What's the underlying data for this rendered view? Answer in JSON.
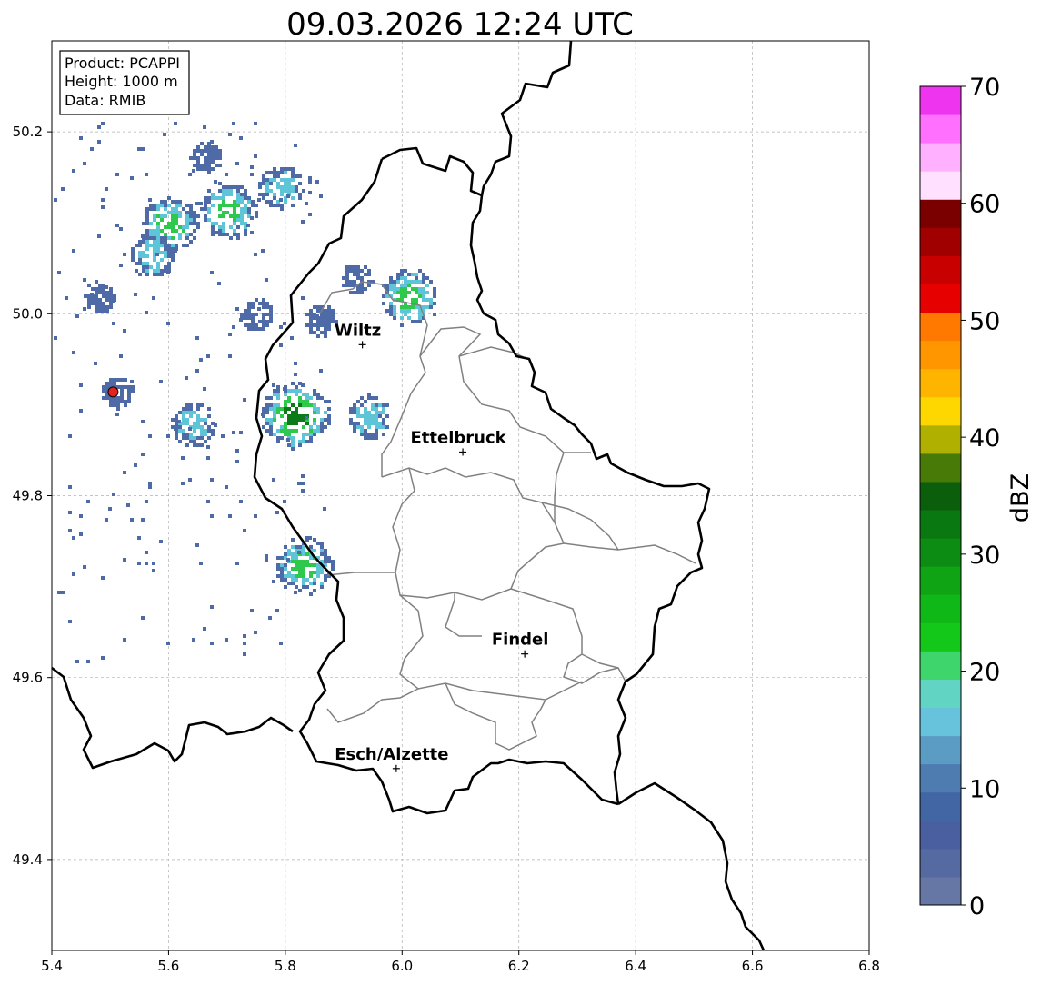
{
  "title": "09.03.2026 12:24 UTC",
  "info_box": {
    "lines": [
      "Product: PCAPPI",
      "Height: 1000 m",
      "Data: RMIB"
    ]
  },
  "axes": {
    "x_ticks": [
      "5.4",
      "5.6",
      "5.8",
      "6.0",
      "6.2",
      "6.4",
      "6.6",
      "6.8"
    ],
    "x_values": [
      5.4,
      5.6,
      5.8,
      6.0,
      6.2,
      6.4,
      6.6,
      6.8
    ],
    "y_ticks": [
      "49.4",
      "49.6",
      "49.8",
      "50.0",
      "50.2"
    ],
    "y_values": [
      49.4,
      49.6,
      49.8,
      50.0,
      50.2
    ],
    "xlim": [
      5.4,
      6.8
    ],
    "ylim": [
      49.3,
      50.3
    ],
    "grid": true
  },
  "cities": [
    {
      "name": "Wiltz",
      "lon": 5.932,
      "lat": 49.966
    },
    {
      "name": "Ettelbruck",
      "lon": 6.104,
      "lat": 49.848
    },
    {
      "name": "Findel",
      "lon": 6.21,
      "lat": 49.626
    },
    {
      "name": "Esch/Alzette",
      "lon": 5.99,
      "lat": 49.5
    }
  ],
  "radar_site": {
    "lon": 5.505,
    "lat": 49.914,
    "color": "#e0241c"
  },
  "colorbar": {
    "label": "dBZ",
    "ticks": [
      "0",
      "10",
      "20",
      "30",
      "40",
      "50",
      "60",
      "70"
    ],
    "tick_values": [
      0,
      10,
      20,
      30,
      40,
      50,
      60,
      70
    ],
    "range": [
      0,
      70
    ],
    "colors": [
      "#6677a6",
      "#566aa2",
      "#4a5fa0",
      "#4266a4",
      "#4e7cb0",
      "#5b9cc5",
      "#67c2dc",
      "#62d4c3",
      "#3ed66c",
      "#14c81a",
      "#0fb816",
      "#0ea414",
      "#0c8c12",
      "#0a7810",
      "#0a5e0c",
      "#487a08",
      "#b0b000",
      "#ffd700",
      "#ffb400",
      "#ff9600",
      "#ff7800",
      "#e60000",
      "#c80000",
      "#a00000",
      "#7a0000",
      "#ffe0ff",
      "#ffb0ff",
      "#ff70ff",
      "#ee34ee"
    ]
  },
  "colors": {
    "border": "#000000",
    "canton_border": "#808080",
    "echo_weak": "#4e6ba8",
    "echo_light": "#5ec5d9",
    "echo_moderate": "#2ec84c",
    "echo_strong": "#0c7a18"
  },
  "echo_cells": [
    {
      "lon": 5.6,
      "lat": 50.1,
      "intensity": 3
    },
    {
      "lon": 5.7,
      "lat": 50.115,
      "intensity": 3
    },
    {
      "lon": 5.79,
      "lat": 50.14,
      "intensity": 2
    },
    {
      "lon": 5.66,
      "lat": 50.175,
      "intensity": 1
    },
    {
      "lon": 5.57,
      "lat": 50.065,
      "intensity": 2
    },
    {
      "lon": 6.01,
      "lat": 50.02,
      "intensity": 3
    },
    {
      "lon": 5.815,
      "lat": 49.89,
      "intensity": 4
    },
    {
      "lon": 5.94,
      "lat": 49.888,
      "intensity": 2
    },
    {
      "lon": 5.86,
      "lat": 49.995,
      "intensity": 1
    },
    {
      "lon": 5.92,
      "lat": 50.04,
      "intensity": 1
    },
    {
      "lon": 5.64,
      "lat": 49.88,
      "intensity": 2
    },
    {
      "lon": 5.83,
      "lat": 49.725,
      "intensity": 3
    },
    {
      "lon": 5.51,
      "lat": 49.916,
      "intensity": 1
    },
    {
      "lon": 5.48,
      "lat": 50.02,
      "intensity": 1
    },
    {
      "lon": 5.75,
      "lat": 50.0,
      "intensity": 1
    }
  ]
}
